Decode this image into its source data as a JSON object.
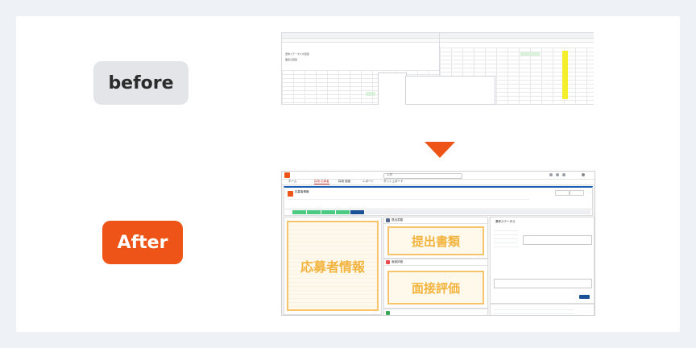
{
  "labels": {
    "before": "before",
    "after": "After"
  },
  "colors": {
    "accent": "#ee5418",
    "highlight": "#f7c46c",
    "highlight_text": "#f3b43f",
    "primary": "#1b5297",
    "success": "#4bca81"
  },
  "before_screen": {
    "note_a": "選考ステータスの回答",
    "note_b": "面接の回答"
  },
  "after_screen": {
    "search_placeholder": "人材",
    "nav": [
      "ホーム",
      "採用 応募者",
      "採用 面接",
      "レポート",
      "ダッシュボード"
    ],
    "record_title": "応募者情報",
    "section_1": "提出書類",
    "section_2": "面接評価",
    "applicant_label": "応募者情報",
    "documents_label": "提出書類",
    "interview_label": "面接評価",
    "comment_heading": "選考ステータス"
  }
}
